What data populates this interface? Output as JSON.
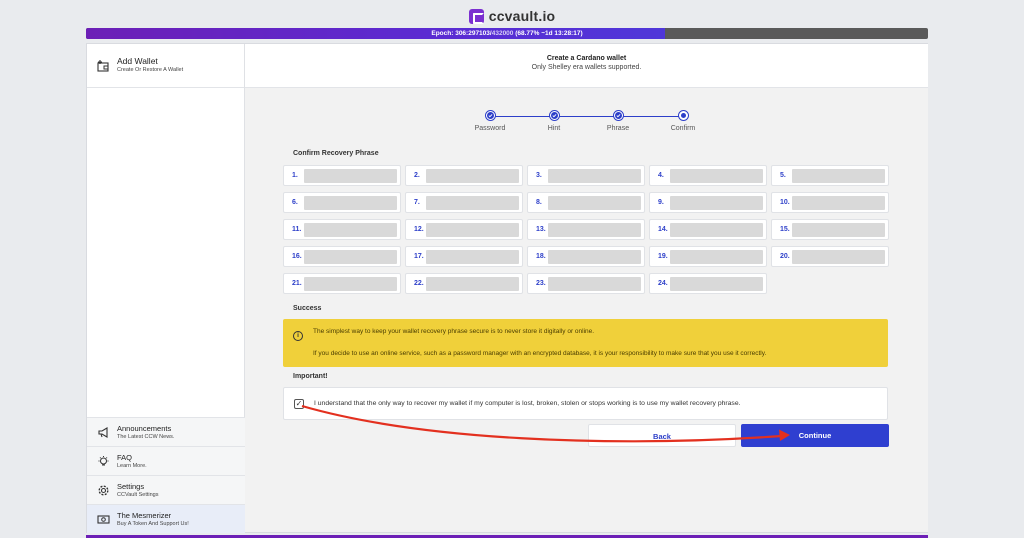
{
  "brand": {
    "name": "ccvault.io"
  },
  "epoch": {
    "prefix": "Epoch: 306:297103/",
    "total": "432000",
    "suffix": " (68.77% ~1d 13:28:17)",
    "progress_percent": 68.77
  },
  "sidebar": {
    "header": {
      "title": "Add Wallet",
      "subtitle": "Create Or Restore A Wallet"
    },
    "items": [
      {
        "title": "Announcements",
        "subtitle": "The Latest CCW News.",
        "icon": "megaphone-icon"
      },
      {
        "title": "FAQ",
        "subtitle": "Learn More.",
        "icon": "lightbulb-icon"
      },
      {
        "title": "Settings",
        "subtitle": "CCVault Settings",
        "icon": "gear-icon"
      },
      {
        "title": "The Mesmerizer",
        "subtitle": "Buy A Token And Support Us!",
        "icon": "money-icon"
      }
    ]
  },
  "header": {
    "title": "Create a Cardano wallet",
    "subtitle": "Only Shelley era wallets supported."
  },
  "steps": [
    {
      "label": "Password",
      "state": "done"
    },
    {
      "label": "Hint",
      "state": "done"
    },
    {
      "label": "Phrase",
      "state": "done"
    },
    {
      "label": "Confirm",
      "state": "current"
    }
  ],
  "recovery": {
    "title": "Confirm Recovery Phrase",
    "word_numbers": [
      "1.",
      "2.",
      "3.",
      "4.",
      "5.",
      "6.",
      "7.",
      "8.",
      "9.",
      "10.",
      "11.",
      "12.",
      "13.",
      "14.",
      "15.",
      "16.",
      "17.",
      "18.",
      "19.",
      "20.",
      "21.",
      "22.",
      "23.",
      "24."
    ]
  },
  "success": {
    "title": "Success",
    "line1": "The simplest way to keep your wallet recovery phrase secure is to never store it digitally or online.",
    "line2": "If you decide to use an online service, such as a password manager with an encrypted database, it is your responsibility to make sure that you use it correctly."
  },
  "important": {
    "title": "Important!",
    "checkbox_checked": true,
    "text": "I understand that the only way to recover my wallet if my computer is lost, broken, stolen or stops working is to use my wallet recovery phrase."
  },
  "buttons": {
    "back": "Back",
    "continue": "Continue"
  },
  "colors": {
    "accent": "#2f3fd0",
    "brand": "#6c1fb6",
    "warning": "#f0d03a",
    "annotation": "#e3301f"
  }
}
